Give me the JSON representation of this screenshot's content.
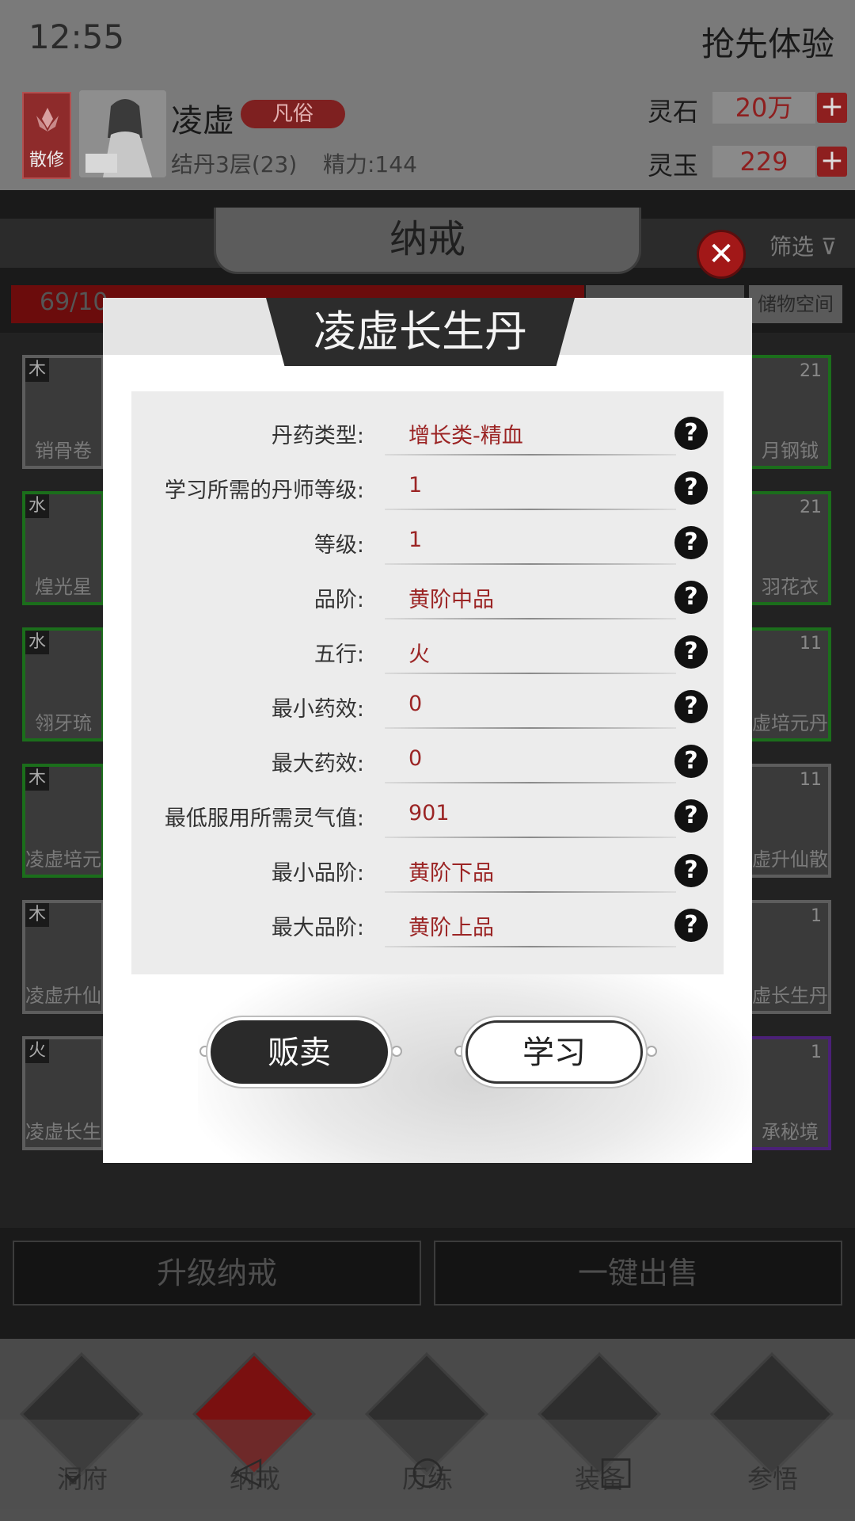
{
  "status": {
    "time": "12:55",
    "early_access": "抢先体验"
  },
  "player": {
    "sect": "散修",
    "name": "凌虚",
    "rank": "凡俗",
    "realm": "结丹3层(23)",
    "energy": "精力:144",
    "spirit_stone_label": "灵石",
    "spirit_stone_value": "20万",
    "spirit_jade_label": "灵玉",
    "spirit_jade_value": "229"
  },
  "bag": {
    "title": "纳戒",
    "filter": "筛选",
    "capacity": "69/10",
    "storage": "储物空间",
    "left_items": [
      {
        "element": "木",
        "name": "销骨卷"
      },
      {
        "element": "水",
        "name": "煌光星"
      },
      {
        "element": "水",
        "name": "翎牙琉"
      },
      {
        "element": "木",
        "name": "凌虚培元"
      },
      {
        "element": "木",
        "name": "凌虚升仙"
      },
      {
        "element": "火",
        "name": "凌虚长生"
      }
    ],
    "right_items": [
      {
        "count": "21",
        "name": "月钢钺"
      },
      {
        "count": "21",
        "name": "羽花衣"
      },
      {
        "count": "11",
        "name": "虚培元丹"
      },
      {
        "count": "11",
        "name": "虚升仙散"
      },
      {
        "count": "1",
        "name": "虚长生丹"
      },
      {
        "count": "1",
        "name": "承秘境"
      }
    ],
    "upgrade_label": "升级纳戒",
    "sell_all_label": "一键出售"
  },
  "nav": [
    "洞府",
    "纳戒",
    "历练",
    "装备",
    "参悟"
  ],
  "modal": {
    "title": "凌虚长生丹",
    "rows": [
      {
        "label": "丹药类型:",
        "value": "增长类-精血"
      },
      {
        "label": "学习所需的丹师等级:",
        "value": "1"
      },
      {
        "label": "等级:",
        "value": "1"
      },
      {
        "label": "品阶:",
        "value": "黄阶中品"
      },
      {
        "label": "五行:",
        "value": "火"
      },
      {
        "label": "最小药效:",
        "value": "0"
      },
      {
        "label": "最大药效:",
        "value": "0"
      },
      {
        "label": "最低服用所需灵气值:",
        "value": "901"
      },
      {
        "label": "最小品阶:",
        "value": "黄阶下品"
      },
      {
        "label": "最大品阶:",
        "value": "黄阶上品"
      }
    ],
    "help_glyph": "?",
    "sell_label": "贩卖",
    "learn_label": "学习"
  },
  "colors": {
    "accent_red": "#9b2424",
    "modal_bg": "#ffffff",
    "dim_overlay": "#7a7a7a"
  }
}
